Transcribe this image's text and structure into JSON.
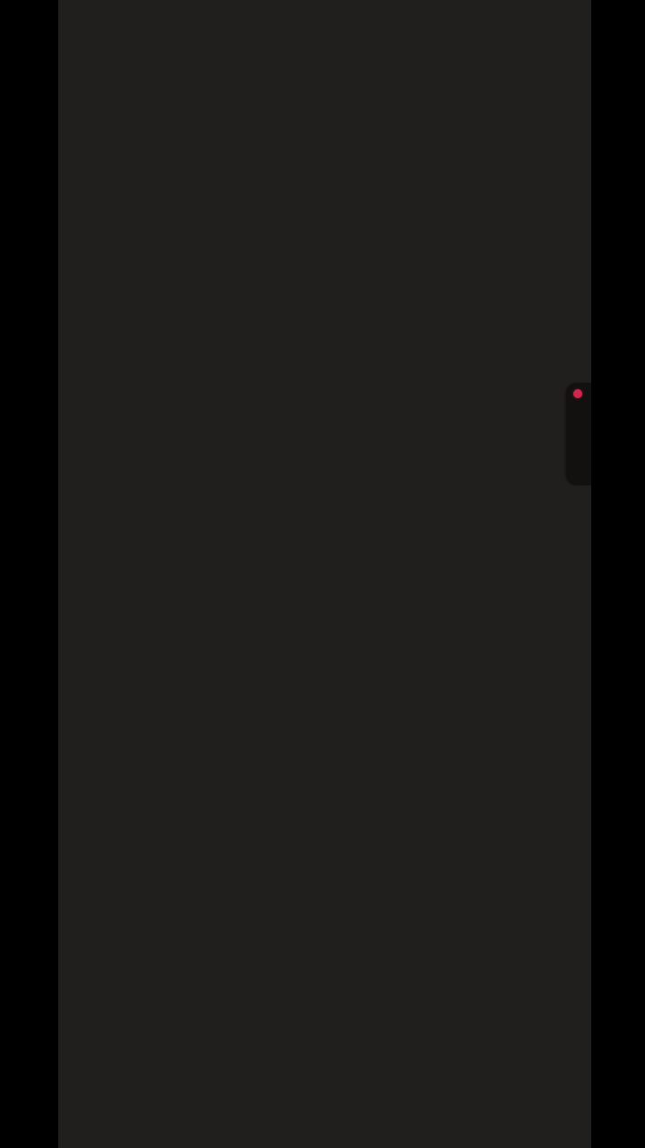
{
  "screen": {
    "background": "#000000",
    "surface_color": "#201f1d"
  },
  "edge_panel": {
    "handle_color": "#121110",
    "indicator_icon": "record-dot-icon",
    "indicator_color": "#d0264c"
  }
}
